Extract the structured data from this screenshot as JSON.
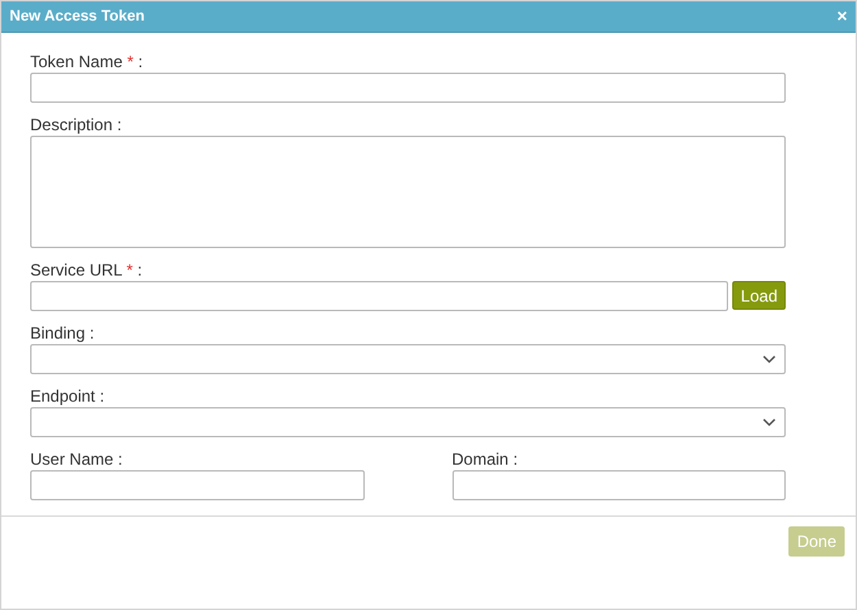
{
  "window": {
    "title": "New Access Token",
    "close": "×"
  },
  "fields": [
    {
      "kind": "text",
      "label": "Token Name",
      "required_mark": "*",
      "colon": ":"
    },
    {
      "kind": "textarea",
      "label": "Description",
      "colon": ":"
    },
    {
      "kind": "load",
      "label": "Service URL",
      "required_mark": "*",
      "colon": ":",
      "button": "Load"
    },
    {
      "kind": "select",
      "label": "Binding",
      "colon": ":"
    },
    {
      "kind": "select",
      "label": "Endpoint",
      "colon": ":"
    },
    {
      "kind": "pair",
      "items": [
        {
          "label": "User Name",
          "colon": ":"
        },
        {
          "label": "Domain",
          "colon": ":"
        }
      ]
    }
  ],
  "footer": {
    "done": {
      "label": "Done",
      "disabled": true
    }
  }
}
